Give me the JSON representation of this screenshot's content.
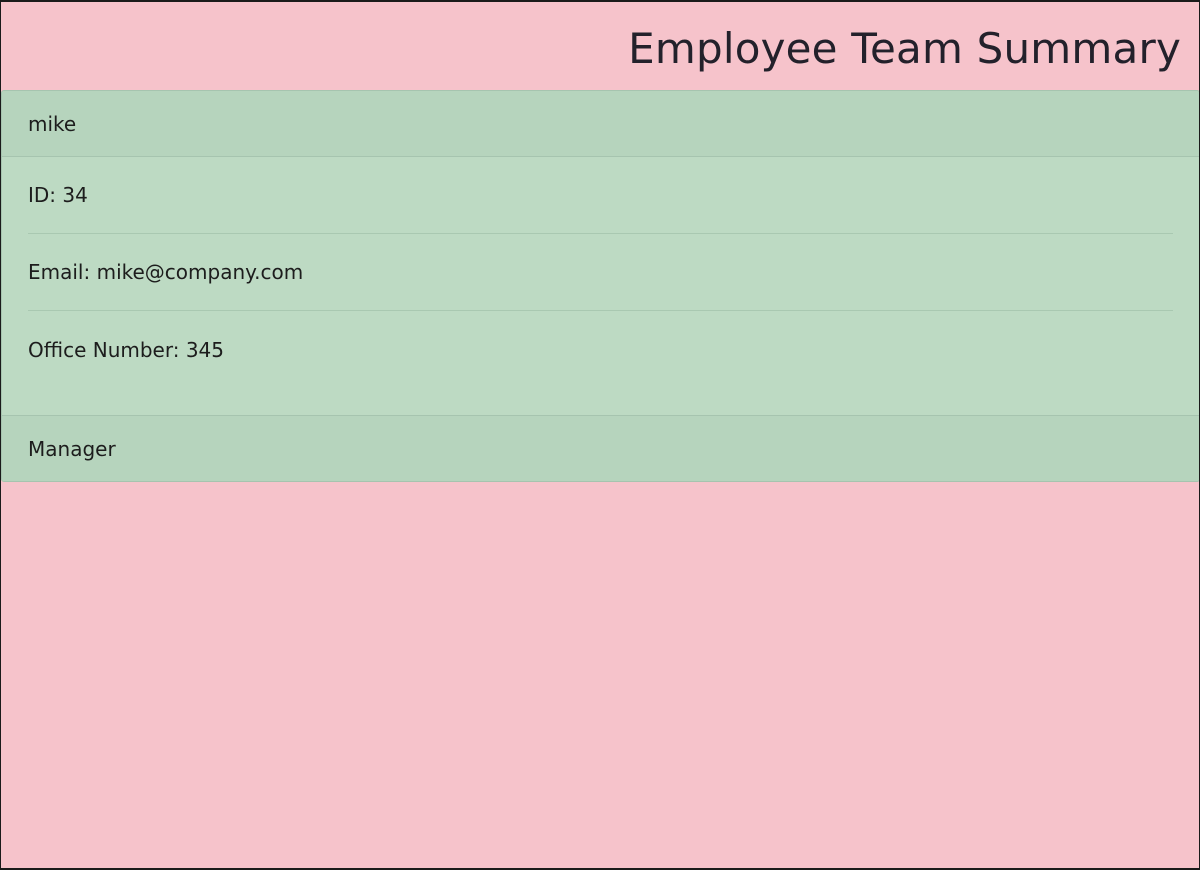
{
  "header": {
    "title": "Employee Team Summary"
  },
  "employees": [
    {
      "name": "mike",
      "id_text": "ID: 34",
      "email_text": "Email: mike@company.com",
      "office_text": "Office Number: 345",
      "role": "Manager"
    }
  ],
  "colors": {
    "page_background": "#f6c3cb",
    "card_background": "#bddac3",
    "card_header_background": "#b6d4bd",
    "text": "#1d1d1d"
  }
}
